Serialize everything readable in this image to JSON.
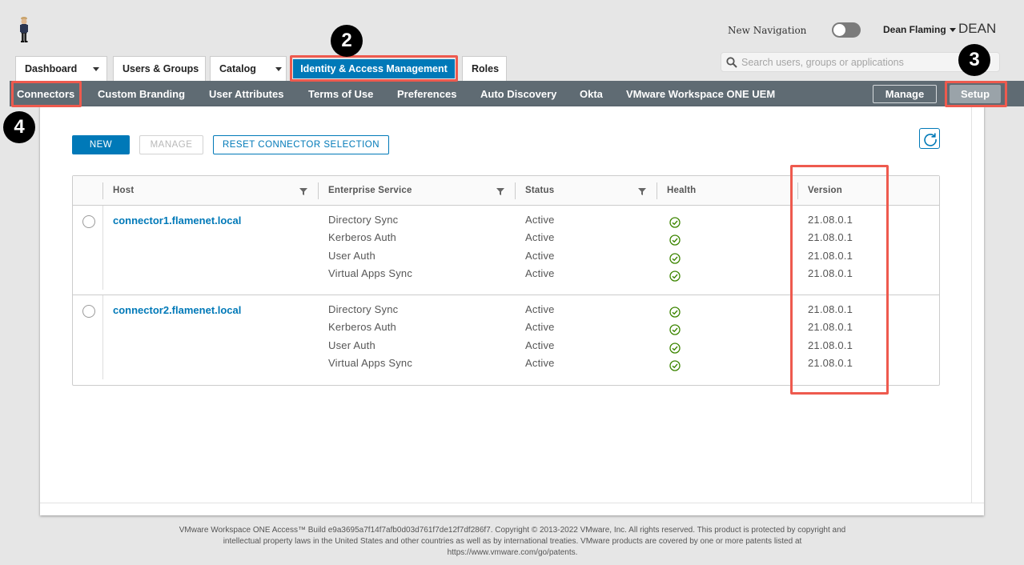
{
  "header": {
    "new_navigation_label": "New Navigation",
    "new_navigation_on": false,
    "user_name": "Dean Flaming",
    "tenant": "DEAN",
    "search_placeholder": "Search users, groups or applications"
  },
  "tabs": [
    {
      "label": "Dashboard",
      "dropdown": true
    },
    {
      "label": "Users & Groups",
      "dropdown": false
    },
    {
      "label": "Catalog",
      "dropdown": true
    },
    {
      "label": "Identity & Access Management",
      "dropdown": false,
      "active": true
    },
    {
      "label": "Roles",
      "dropdown": false
    }
  ],
  "subnav": {
    "items": [
      "Connectors",
      "Custom Branding",
      "User Attributes",
      "Terms of Use",
      "Preferences",
      "Auto Discovery",
      "Okta",
      "VMware Workspace ONE UEM"
    ],
    "manage_label": "Manage",
    "setup_label": "Setup"
  },
  "callouts": [
    "2",
    "3",
    "4"
  ],
  "toolbar": {
    "new_label": "NEW",
    "manage_label": "MANAGE",
    "reset_label": "RESET CONNECTOR SELECTION"
  },
  "grid": {
    "columns": [
      "Host",
      "Enterprise Service",
      "Status",
      "Health",
      "Version"
    ],
    "rows": [
      {
        "host": "connector1.flamenet.local",
        "services": [
          "Directory Sync",
          "Kerberos Auth",
          "User Auth",
          "Virtual Apps Sync"
        ],
        "statuses": [
          "Active",
          "Active",
          "Active",
          "Active"
        ],
        "versions": [
          "21.08.0.1",
          "21.08.0.1",
          "21.08.0.1",
          "21.08.0.1"
        ]
      },
      {
        "host": "connector2.flamenet.local",
        "services": [
          "Directory Sync",
          "Kerberos Auth",
          "User Auth",
          "Virtual Apps Sync"
        ],
        "statuses": [
          "Active",
          "Active",
          "Active",
          "Active"
        ],
        "versions": [
          "21.08.0.1",
          "21.08.0.1",
          "21.08.0.1",
          "21.08.0.1"
        ]
      }
    ]
  },
  "footer": {
    "line1": "VMware Workspace ONE Access™ Build e9a3695a7f14f7afb0d03d761f7de12f7df286f7. Copyright © 2013-2022 VMware, Inc. All rights reserved. This product is protected by copyright and",
    "line2": "intellectual property laws in the United States and other countries as well as by international treaties. VMware products are covered by one or more patents listed at",
    "line3": "https://www.vmware.com/go/patents."
  },
  "colors": {
    "primary": "#0079b8",
    "subnav": "#5f6b73",
    "highlight": "#ee5a4e",
    "health_ok": "#3c8500"
  }
}
